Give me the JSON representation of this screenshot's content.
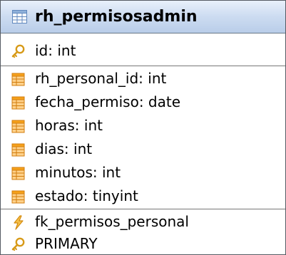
{
  "table": {
    "name": "rh_permisosadmin",
    "primary_key": {
      "label": "id: int",
      "icon": "key-icon"
    },
    "columns": [
      {
        "label": "rh_personal_id: int",
        "icon": "column-field-icon"
      },
      {
        "label": "fecha_permiso: date",
        "icon": "column-field-icon"
      },
      {
        "label": "horas: int",
        "icon": "column-field-icon"
      },
      {
        "label": "dias: int",
        "icon": "column-field-icon"
      },
      {
        "label": "minutos: int",
        "icon": "column-field-icon"
      },
      {
        "label": "estado: tinyint",
        "icon": "column-field-icon"
      }
    ],
    "indexes": [
      {
        "label": "fk_permisos_personal",
        "icon": "foreign-key-icon"
      },
      {
        "label": "PRIMARY",
        "icon": "primary-key-icon"
      }
    ]
  },
  "colors": {
    "header_top": "#e8f0fb",
    "header_bottom": "#b9cde9",
    "border": "#555b63",
    "column_icon": "#f6a11b",
    "key_icon": "#d79a18",
    "foreign_key_icon": "#f0b52a"
  }
}
